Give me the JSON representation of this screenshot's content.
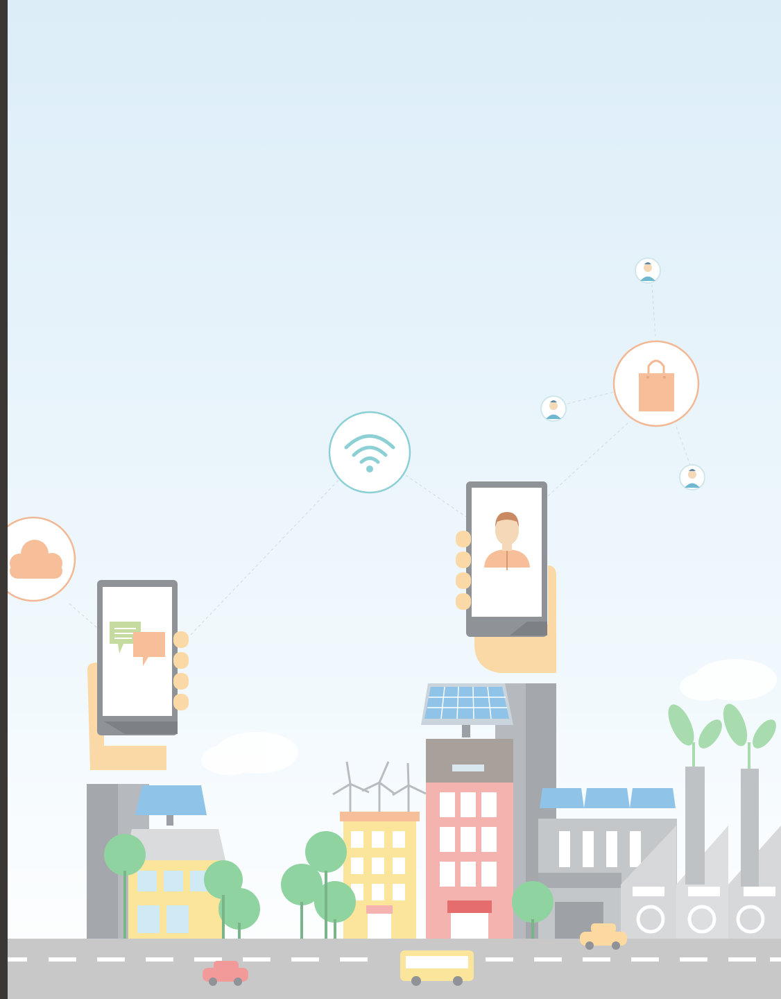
{
  "scene": {
    "type": "smart-city-illustration",
    "colors": {
      "sky_top": "#dcedf8",
      "sky_bottom": "#ffffff",
      "frame": "#3b3734",
      "road": "#c8c8c8",
      "peach": "#f6bf9a",
      "peach_line": "#f2b894",
      "teal": "#8ccfd4",
      "phone": "#9e9e9e",
      "skin": "#fad9a7",
      "solar": "#8fc3e8",
      "green_leaf": "#a8dcae",
      "tree": "#8fd3a0"
    },
    "icons": [
      "cloud-icon",
      "wifi-icon",
      "shopping-bag-icon",
      "user-icon",
      "chat-icon",
      "person-icon",
      "wind-turbine-icon",
      "solar-panel-icon",
      "recycle-icon",
      "leaf-icon"
    ]
  }
}
